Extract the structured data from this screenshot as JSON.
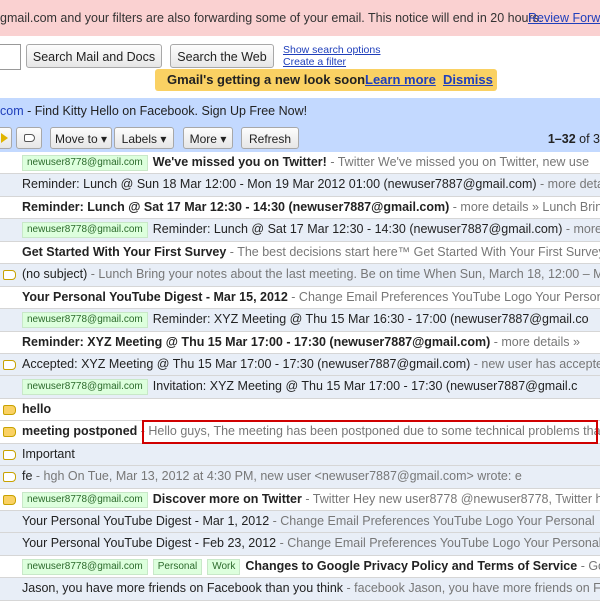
{
  "notice": {
    "text": "gmail.com and your filters are also forwarding some of your email. This notice will end in 20 hours.",
    "link": "Review Forwa"
  },
  "search": {
    "mail_button": "Search Mail and Docs",
    "web_button": "Search the Web",
    "show_options": "Show search options",
    "create_filter": "Create a filter"
  },
  "newlook": {
    "message": "Gmail's getting a new look soon.",
    "learn_more": "Learn more",
    "dismiss": "Dismiss"
  },
  "ad": {
    "prefix": "com",
    "text": " - Find Kitty Hello on Facebook. Sign Up Free Now!"
  },
  "toolbar": {
    "move_to": "Move to ▾",
    "labels": "Labels ▾",
    "more": "More ▾",
    "refresh": "Refresh",
    "count_range": "1–32",
    "count_rest": " of 3"
  },
  "emails": [
    {
      "state": "unread",
      "label_icon": "none",
      "tags": [
        "newuser8778@gmail.com"
      ],
      "subject": "We've missed you on Twitter!",
      "snippet": " - Twitter We've missed you on Twitter, new use"
    },
    {
      "state": "read",
      "label_icon": "none",
      "tags": [],
      "subject": "Reminder: Lunch @ Sun 18 Mar 12:00 - Mon 19 Mar 2012 01:00 (newuser7887@gmail.com)",
      "snippet": " - more details"
    },
    {
      "state": "unread",
      "label_icon": "none",
      "tags": [],
      "subject": "Reminder: Lunch @ Sat 17 Mar 12:30 - 14:30 (newuser7887@gmail.com)",
      "snippet": " - more details » Lunch Bring"
    },
    {
      "state": "read",
      "label_icon": "none",
      "tags": [
        "newuser8778@gmail.com"
      ],
      "subject": "Reminder: Lunch @ Sat 17 Mar 12:30 - 14:30 (newuser7887@gmail.com)",
      "snippet": " - more de"
    },
    {
      "state": "unread",
      "label_icon": "none",
      "tags": [],
      "subject": "Get Started With Your First Survey",
      "snippet": " - The best decisions start here™ Get Started With Your First Survey"
    },
    {
      "state": "read",
      "label_icon": "empty",
      "tags": [],
      "subject": "(no subject)",
      "snippet": " - Lunch Bring your notes about the last meeting. Be on time When Sun, March 18, 12:00 – Mon"
    },
    {
      "state": "unread",
      "label_icon": "none",
      "tags": [],
      "subject": "Your Personal YouTube Digest - Mar 15, 2012",
      "snippet": " - Change Email Preferences YouTube Logo Your Persona"
    },
    {
      "state": "read",
      "label_icon": "none",
      "tags": [
        "newuser8778@gmail.com"
      ],
      "subject": "Reminder: XYZ Meeting @ Thu 15 Mar 16:30 - 17:00 (newuser7887@gmail.co",
      "snippet": ""
    },
    {
      "state": "unread",
      "label_icon": "none",
      "tags": [],
      "subject": "Reminder: XYZ Meeting @ Thu 15 Mar 17:00 - 17:30 (newuser7887@gmail.com)",
      "snippet": " - more details »"
    },
    {
      "state": "read",
      "label_icon": "empty",
      "tags": [],
      "subject": "Accepted: XYZ Meeting @ Thu 15 Mar 17:00 - 17:30 (newuser7887@gmail.com)",
      "snippet": " - new user has accepted t"
    },
    {
      "state": "read",
      "label_icon": "none",
      "tags": [
        "newuser8778@gmail.com"
      ],
      "subject": "Invitation: XYZ Meeting @ Thu 15 Mar 17:00 - 17:30 (newuser7887@gmail.c",
      "snippet": ""
    },
    {
      "state": "unread",
      "label_icon": "filled",
      "tags": [],
      "subject": "hello",
      "snippet": ""
    },
    {
      "state": "unread",
      "label_icon": "filled",
      "tags": [],
      "subject": "meeting postponed",
      "snippet": " - Hello guys, The meeting has been postponed due to some technical problems that"
    },
    {
      "state": "read",
      "label_icon": "empty",
      "tags": [],
      "subject": "Important",
      "snippet": ""
    },
    {
      "state": "read",
      "label_icon": "empty",
      "tags": [],
      "subject": "fe",
      "snippet": " - hgh On Tue, Mar 13, 2012 at 4:30 PM, new user <newuser7887@gmail.com> wrote: e"
    },
    {
      "state": "unread",
      "label_icon": "filled",
      "tags": [
        "newuser8778@gmail.com"
      ],
      "subject": "Discover more on Twitter",
      "snippet": " - Twitter Hey new user8778 @newuser8778, Twitter h"
    },
    {
      "state": "read",
      "label_icon": "none",
      "tags": [],
      "subject": "Your Personal YouTube Digest - Mar 1, 2012",
      "snippet": " - Change Email Preferences YouTube Logo Your Personal"
    },
    {
      "state": "read",
      "label_icon": "none",
      "tags": [],
      "subject": "Your Personal YouTube Digest - Feb 23, 2012",
      "snippet": " - Change Email Preferences YouTube Logo Your Personal Y"
    },
    {
      "state": "unread",
      "label_icon": "none",
      "tags": [
        "newuser8778@gmail.com",
        "Personal",
        "Work"
      ],
      "subject": "Changes to Google Privacy Policy and Terms of Service",
      "snippet": " - Goo"
    },
    {
      "state": "read",
      "label_icon": "none",
      "tags": [],
      "subject": "Jason, you have more friends on Facebook than you think",
      "snippet": " - facebook Jason, you have more friends on Faceb"
    }
  ]
}
